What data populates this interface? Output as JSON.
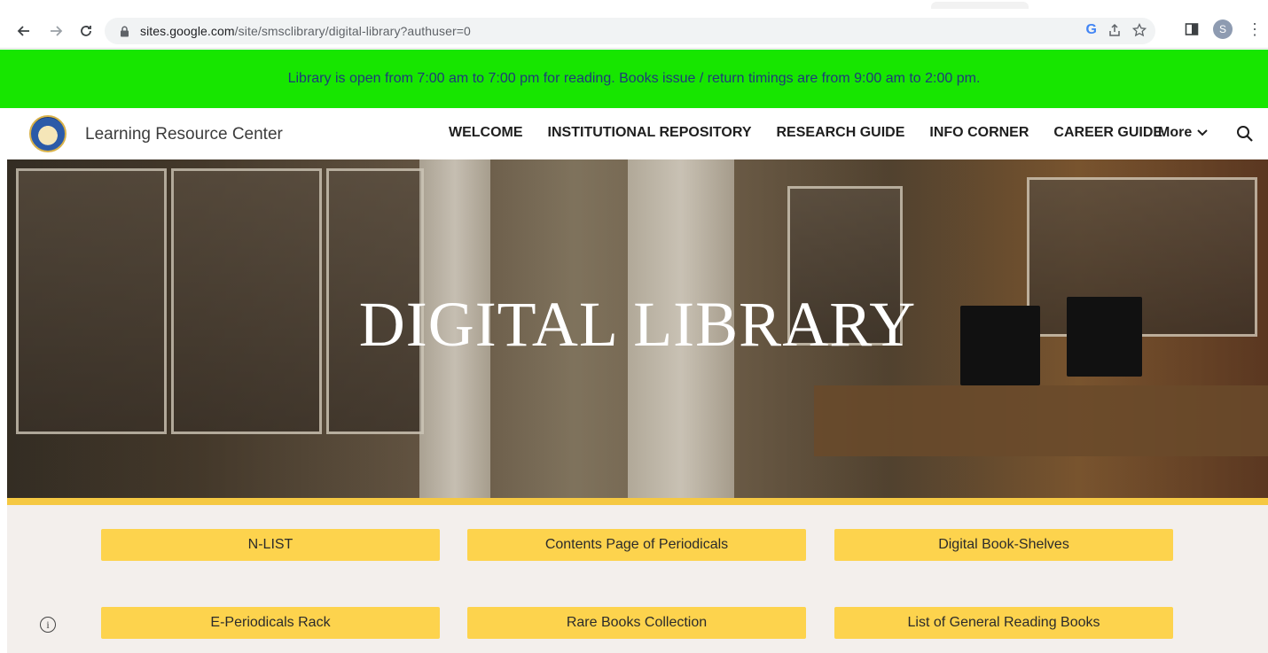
{
  "browser": {
    "url_host": "sites.google.com",
    "url_path": "/site/smsclibrary/digital-library?authuser=0",
    "profile_initial": "S",
    "toolbar_g": "G"
  },
  "announcement": {
    "text": "Library is open from 7:00 am to 7:00 pm for reading. Books issue / return timings are from 9:00 am to 2:00 pm."
  },
  "site": {
    "title": "Learning Resource Center",
    "nav": [
      "WELCOME",
      "INSTITUTIONAL REPOSITORY",
      "RESEARCH GUIDE",
      "INFO CORNER",
      "CAREER GUIDE"
    ],
    "more_label": "More"
  },
  "hero": {
    "title": "DIGITAL LIBRARY"
  },
  "tiles": [
    "N-LIST",
    "Contents Page of Periodicals",
    "Digital Book-Shelves",
    "E-Periodicals Rack",
    "Rare Books Collection",
    "List of General Reading Books"
  ],
  "colors": {
    "announcement_bg": "#17e600",
    "accent": "#f5c842",
    "tile_bg": "#fdd34d",
    "content_bg": "#f3efec"
  },
  "icons": [
    "back-icon",
    "forward-icon",
    "reload-icon",
    "lock-icon",
    "share-icon",
    "star-icon",
    "side-panel-icon",
    "more-vert-icon",
    "search-icon",
    "chevron-down-icon",
    "info-icon"
  ]
}
